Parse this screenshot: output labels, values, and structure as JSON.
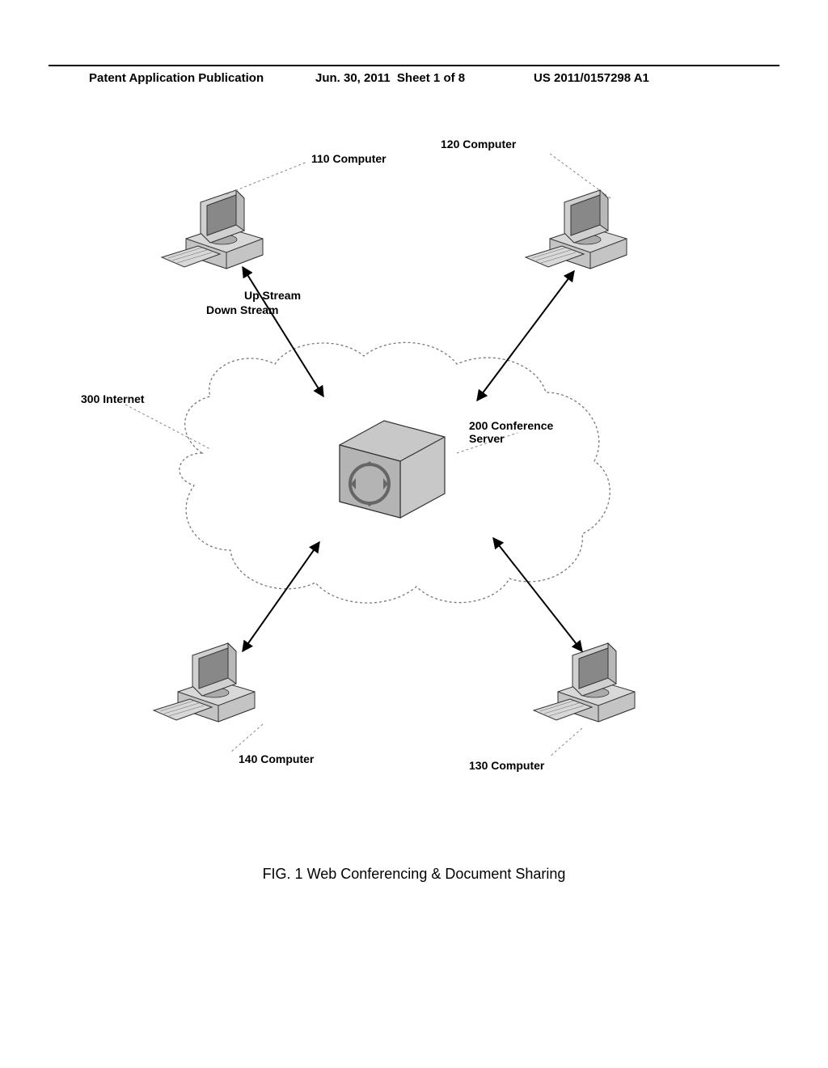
{
  "header": {
    "left": "Patent Application Publication",
    "date": "Jun. 30, 2011",
    "sheet": "Sheet 1 of 8",
    "pubno": "US 2011/0157298 A1"
  },
  "labels": {
    "c110": "110 Computer",
    "c120": "120 Computer",
    "c130": "130 Computer",
    "c140": "140 Computer",
    "server": "200 Conference\nServer",
    "internet": "300 Internet",
    "up": "Up Stream",
    "down": "Down Stream"
  },
  "caption": "FIG. 1 Web Conferencing & Document Sharing"
}
